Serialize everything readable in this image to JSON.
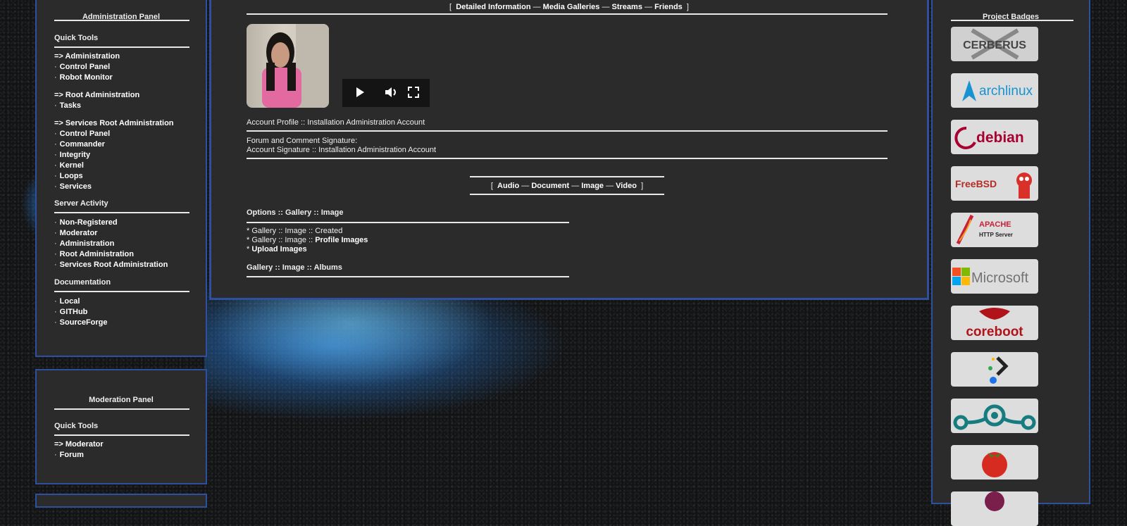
{
  "admin_panel": {
    "title": "Administration Panel",
    "quick_tools": "Quick Tools",
    "groups": [
      {
        "heading": "=> Administration",
        "items": [
          "Control Panel",
          "Robot Monitor"
        ]
      },
      {
        "heading": "=> Root Administration",
        "items": [
          "Tasks"
        ]
      },
      {
        "heading": "=> Services Root Administration",
        "items": [
          "Control Panel",
          "Commander",
          "Integrity",
          "Kernel",
          "Loops",
          "Services"
        ]
      }
    ],
    "server_activity": {
      "title": "Server Activity",
      "items": [
        "Non-Registered",
        "Moderator",
        "Administration",
        "Root Administration",
        "Services Root Administration"
      ]
    },
    "documentation": {
      "title": "Documentation",
      "items": [
        "Local",
        "GITHub",
        "SourceForge"
      ]
    }
  },
  "moderation_panel": {
    "title": "Moderation Panel",
    "quick_tools": "Quick Tools",
    "heading": "=> Moderator",
    "items": [
      "Forum"
    ]
  },
  "main": {
    "top_nav": {
      "open": "[",
      "close": "]",
      "sep": "—",
      "links": [
        "Detailed Information",
        "Media Galleries",
        "Streams",
        "Friends"
      ]
    },
    "account_profile": "Account Profile :: Installation Administration Account",
    "signature_label": "Forum and Comment Signature:",
    "signature_value": "Account Signature :: Installation Administration Account",
    "media_nav": {
      "open": "[",
      "close": "]",
      "sep": "—",
      "links": [
        "Audio",
        "Document",
        "Image",
        "Video"
      ]
    },
    "options": {
      "title": "Options :: Gallery :: Image",
      "line1": "* Gallery :: Image :: Created",
      "line2_prefix": "* Gallery :: Image :: ",
      "line2_link": "Profile Images",
      "line3_prefix": "* ",
      "line3_link": "Upload Images"
    },
    "albums_title": "Gallery :: Image :: Albums"
  },
  "media_player": {
    "icons": [
      "play-icon",
      "volume-icon",
      "fullscreen-icon"
    ]
  },
  "right_panel": {
    "title": "Project Badges",
    "badges": [
      {
        "name": "cerberus-badge",
        "text": "CERBERUS",
        "color": "#555555"
      },
      {
        "name": "archlinux-badge",
        "text": "archlinux",
        "color": "#1793d1"
      },
      {
        "name": "debian-badge",
        "text": "debian",
        "color": "#a80030"
      },
      {
        "name": "freebsd-badge",
        "text": "FreeBSD",
        "color": "#b52b27"
      },
      {
        "name": "apache-badge",
        "text": "APACHE",
        "subtext": "HTTP Server",
        "color": "#c92037"
      },
      {
        "name": "microsoft-badge",
        "text": "Microsoft",
        "color": "#737373"
      },
      {
        "name": "coreboot-badge",
        "text": "coreboot",
        "color": "#b01319"
      },
      {
        "name": "prompt-badge",
        "text": "",
        "color": "#1b1b1b"
      },
      {
        "name": "lineage-badge",
        "text": "",
        "color": "#167c80"
      },
      {
        "name": "tomato-badge",
        "text": "",
        "color": "#d62b20"
      }
    ]
  }
}
